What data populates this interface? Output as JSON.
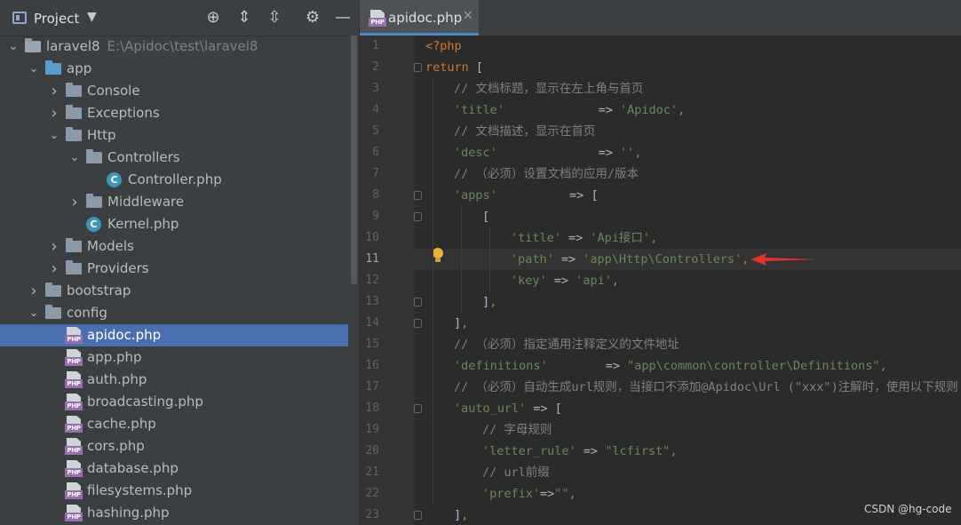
{
  "project_panel": {
    "title": "Project",
    "tree": [
      {
        "label": "laravel8",
        "extra": "E:\\Apidoc\\test\\laravel8",
        "type": "folder-dark",
        "expanded": true,
        "depth": 0
      },
      {
        "label": "app",
        "type": "folder-blue",
        "expanded": true,
        "depth": 1
      },
      {
        "label": "Console",
        "type": "folder",
        "expanded": false,
        "depth": 2
      },
      {
        "label": "Exceptions",
        "type": "folder",
        "expanded": false,
        "depth": 2
      },
      {
        "label": "Http",
        "type": "folder",
        "expanded": true,
        "depth": 2
      },
      {
        "label": "Controllers",
        "type": "folder",
        "expanded": true,
        "depth": 3
      },
      {
        "label": "Controller.php",
        "type": "class",
        "depth": 4
      },
      {
        "label": "Middleware",
        "type": "folder",
        "expanded": false,
        "depth": 3
      },
      {
        "label": "Kernel.php",
        "type": "class",
        "depth": 3
      },
      {
        "label": "Models",
        "type": "folder",
        "expanded": false,
        "depth": 2
      },
      {
        "label": "Providers",
        "type": "folder",
        "expanded": false,
        "depth": 2
      },
      {
        "label": "bootstrap",
        "type": "folder",
        "expanded": false,
        "depth": 1
      },
      {
        "label": "config",
        "type": "folder",
        "expanded": true,
        "depth": 1
      },
      {
        "label": "apidoc.php",
        "type": "php",
        "depth": 2,
        "selected": true
      },
      {
        "label": "app.php",
        "type": "php",
        "depth": 2
      },
      {
        "label": "auth.php",
        "type": "php",
        "depth": 2
      },
      {
        "label": "broadcasting.php",
        "type": "php",
        "depth": 2
      },
      {
        "label": "cache.php",
        "type": "php",
        "depth": 2
      },
      {
        "label": "cors.php",
        "type": "php",
        "depth": 2
      },
      {
        "label": "database.php",
        "type": "php",
        "depth": 2
      },
      {
        "label": "filesystems.php",
        "type": "php",
        "depth": 2
      },
      {
        "label": "hashing.php",
        "type": "php",
        "depth": 2
      }
    ]
  },
  "editor": {
    "tab_label": "apidoc.php",
    "file_badge": "PHP",
    "current_line": 11,
    "lines": [
      {
        "n": "1",
        "indent": 0,
        "parts": [
          [
            "kw",
            "<?php"
          ]
        ]
      },
      {
        "n": "2",
        "indent": 0,
        "parts": [
          [
            "kw",
            "return"
          ],
          [
            "t",
            " ["
          ]
        ]
      },
      {
        "n": "3",
        "indent": 1,
        "parts": [
          [
            "cm",
            "// 文档标题，显示在左上角与首页"
          ]
        ]
      },
      {
        "n": "4",
        "indent": 1,
        "parts": [
          [
            "str",
            "'title'"
          ],
          [
            "t",
            "             => "
          ],
          [
            "str",
            "'Apidoc'"
          ],
          [
            "kw",
            ","
          ]
        ]
      },
      {
        "n": "5",
        "indent": 1,
        "parts": [
          [
            "cm",
            "// 文档描述，显示在首页"
          ]
        ]
      },
      {
        "n": "6",
        "indent": 1,
        "parts": [
          [
            "str",
            "'desc'"
          ],
          [
            "t",
            "              => "
          ],
          [
            "str",
            "''"
          ],
          [
            "kw",
            ","
          ]
        ]
      },
      {
        "n": "7",
        "indent": 1,
        "parts": [
          [
            "cm",
            "// （必须）设置文档的应用/版本"
          ]
        ]
      },
      {
        "n": "8",
        "indent": 1,
        "parts": [
          [
            "str",
            "'apps'"
          ],
          [
            "t",
            "          => ["
          ]
        ]
      },
      {
        "n": "9",
        "indent": 2,
        "parts": [
          [
            "t",
            "["
          ]
        ]
      },
      {
        "n": "10",
        "indent": 3,
        "parts": [
          [
            "str",
            "'title'"
          ],
          [
            "t",
            " => "
          ],
          [
            "str",
            "'Api接口'"
          ],
          [
            "kw",
            ","
          ]
        ]
      },
      {
        "n": "11",
        "indent": 3,
        "parts": [
          [
            "str",
            "'path'"
          ],
          [
            "t",
            " => "
          ],
          [
            "str",
            "'app\\Http\\Controllers'"
          ],
          [
            "kw",
            ","
          ]
        ]
      },
      {
        "n": "12",
        "indent": 3,
        "parts": [
          [
            "str",
            "'key'"
          ],
          [
            "t",
            " => "
          ],
          [
            "str",
            "'api'"
          ],
          [
            "kw",
            ","
          ]
        ]
      },
      {
        "n": "13",
        "indent": 2,
        "parts": [
          [
            "t",
            "]"
          ],
          [
            "kw",
            ","
          ]
        ]
      },
      {
        "n": "14",
        "indent": 1,
        "parts": [
          [
            "t",
            "]"
          ],
          [
            "kw",
            ","
          ]
        ]
      },
      {
        "n": "15",
        "indent": 1,
        "parts": [
          [
            "cm",
            "// （必须）指定通用注释定义的文件地址"
          ]
        ]
      },
      {
        "n": "16",
        "indent": 1,
        "parts": [
          [
            "str",
            "'definitions'"
          ],
          [
            "t",
            "        => "
          ],
          [
            "str",
            "\"app\\common\\controller\\Definitions\""
          ],
          [
            "kw",
            ","
          ]
        ]
      },
      {
        "n": "17",
        "indent": 1,
        "parts": [
          [
            "cm",
            "// （必须）自动生成url规则，当接口不添加@Apidoc\\Url (\"xxx\")注解时，使用以下规则"
          ]
        ]
      },
      {
        "n": "18",
        "indent": 1,
        "parts": [
          [
            "str",
            "'auto_url'"
          ],
          [
            "t",
            " => ["
          ]
        ]
      },
      {
        "n": "19",
        "indent": 2,
        "parts": [
          [
            "cm",
            "// 字母规则"
          ]
        ]
      },
      {
        "n": "20",
        "indent": 2,
        "parts": [
          [
            "str",
            "'letter_rule'"
          ],
          [
            "t",
            " => "
          ],
          [
            "str",
            "\"lcfirst\""
          ],
          [
            "kw",
            ","
          ]
        ]
      },
      {
        "n": "21",
        "indent": 2,
        "parts": [
          [
            "cm",
            "// url前缀"
          ]
        ]
      },
      {
        "n": "22",
        "indent": 2,
        "parts": [
          [
            "str",
            "'prefix'"
          ],
          [
            "t",
            "=>"
          ],
          [
            "str",
            "\"\""
          ],
          [
            "kw",
            ","
          ]
        ]
      },
      {
        "n": "23",
        "indent": 1,
        "parts": [
          [
            "t",
            "]"
          ],
          [
            "kw",
            ","
          ]
        ]
      }
    ]
  },
  "colors": {
    "accent": "#4b6eaf",
    "keyword": "#cc7832",
    "string": "#6a8759",
    "comment": "#808080",
    "annotation_arrow": "#e03030"
  },
  "watermark": "CSDN @hg-code"
}
